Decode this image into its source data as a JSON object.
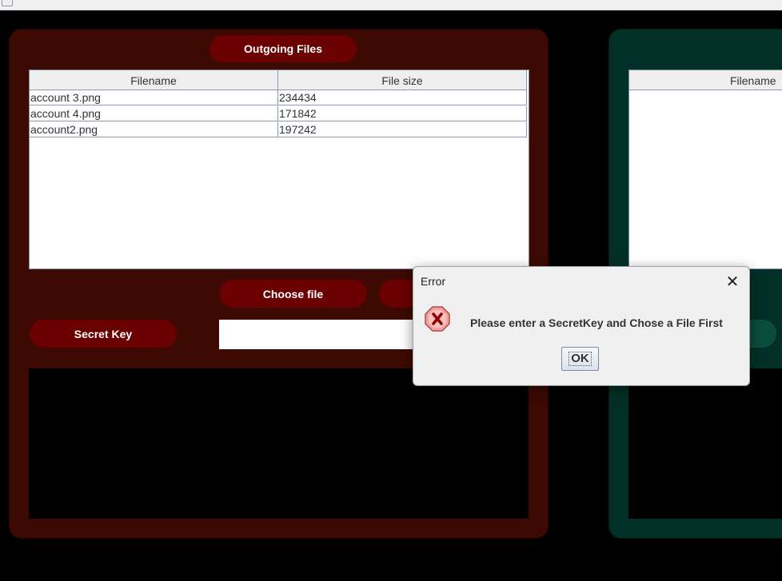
{
  "left_panel": {
    "title": "Outgoing Files",
    "columns": [
      "Filename",
      "File size"
    ],
    "rows": [
      [
        "account 3.png",
        "234434"
      ],
      [
        "account 4.png",
        "171842"
      ],
      [
        "account2.png",
        "197242"
      ]
    ],
    "choose_file_label": "Choose file",
    "secret_key_label": "Secret Key",
    "secret_key_value": ""
  },
  "right_panel": {
    "columns": [
      "Filename"
    ]
  },
  "dialog": {
    "title": "Error",
    "close_glyph": "✕",
    "message": "Please enter a SecretKey and Chose a File First",
    "ok_label": "OK",
    "icon": "error-icon"
  },
  "colors": {
    "left_panel_bg": "#3c0a02",
    "right_panel_bg": "#033026",
    "pill_bg": "#6b0000",
    "right_pill_bg": "#0b4d3c"
  }
}
